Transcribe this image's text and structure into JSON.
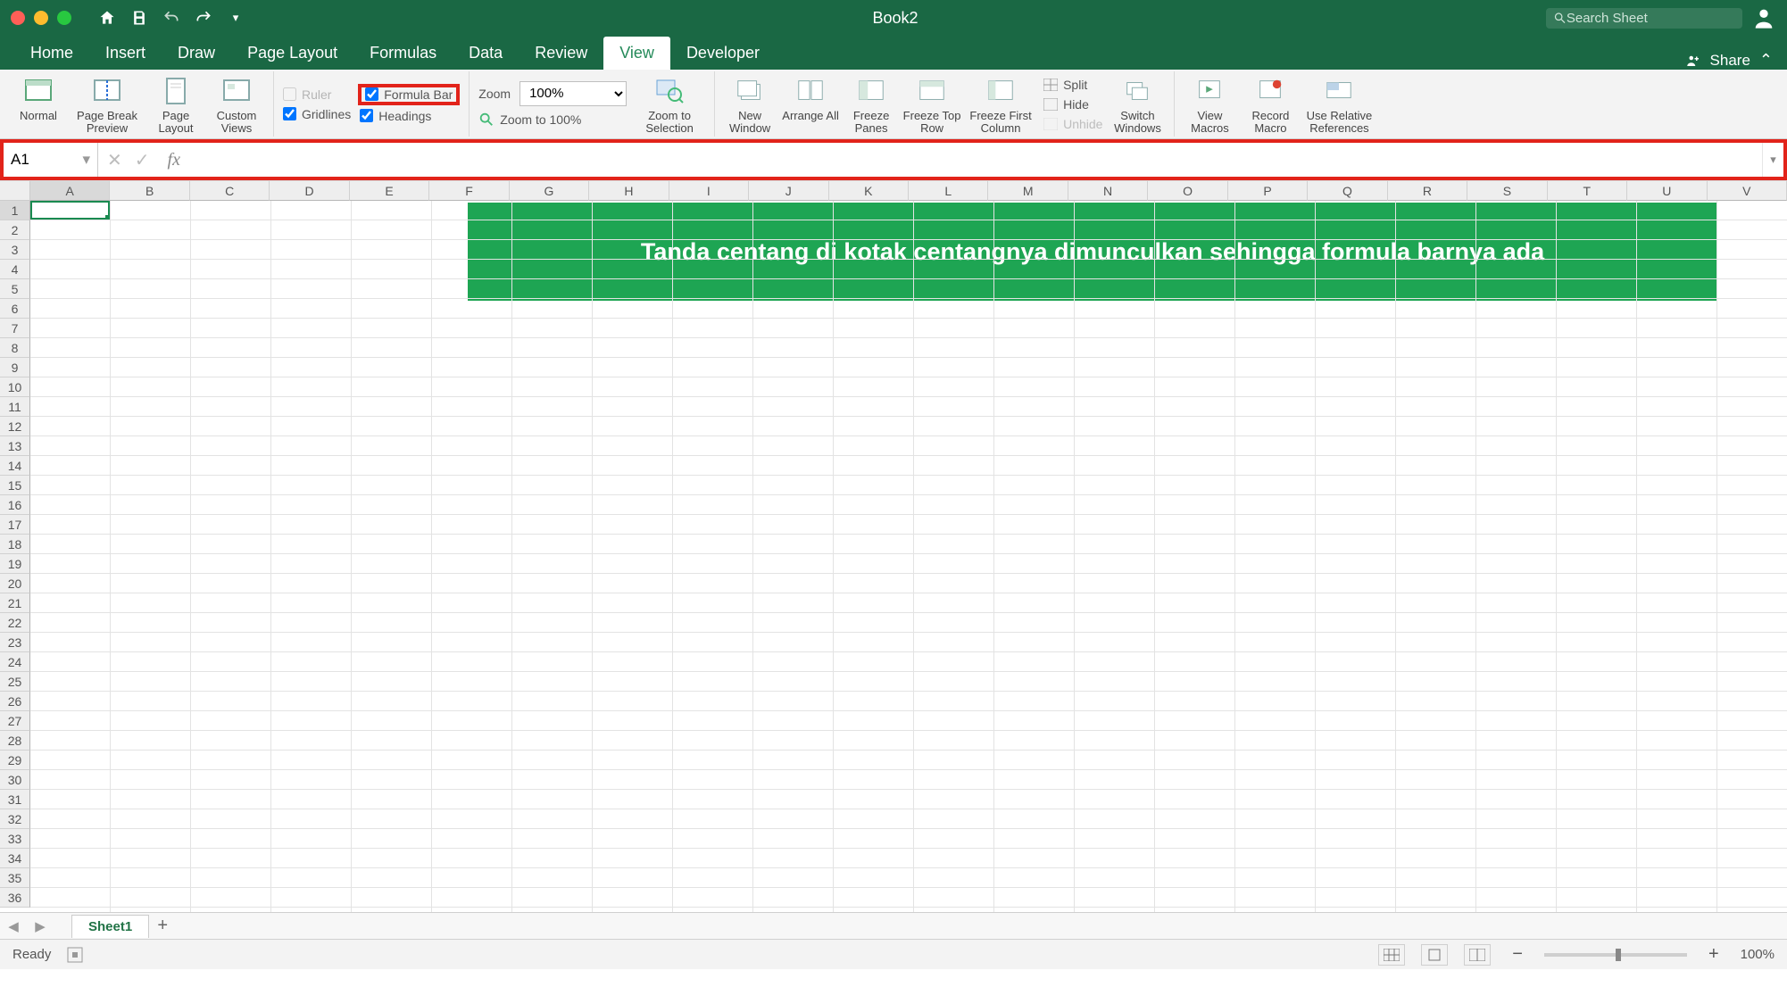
{
  "title": "Book2",
  "search_placeholder": "Search Sheet",
  "tabs": [
    "Home",
    "Insert",
    "Draw",
    "Page Layout",
    "Formulas",
    "Data",
    "Review",
    "View",
    "Developer"
  ],
  "active_tab": "View",
  "share_label": "Share",
  "ribbon": {
    "views": {
      "normal": "Normal",
      "page_break": "Page Break Preview",
      "page_layout": "Page Layout",
      "custom": "Custom Views"
    },
    "show": {
      "ruler": "Ruler",
      "formula_bar": "Formula Bar",
      "gridlines": "Gridlines",
      "headings": "Headings",
      "ruler_checked": false,
      "formula_bar_checked": true,
      "gridlines_checked": true,
      "headings_checked": true
    },
    "zoom": {
      "label": "Zoom",
      "value": "100%",
      "to_100": "Zoom to 100%",
      "to_selection": "Zoom to Selection"
    },
    "window": {
      "new": "New Window",
      "arrange": "Arrange All",
      "freeze_panes": "Freeze Panes",
      "freeze_top": "Freeze Top Row",
      "freeze_first": "Freeze First Column",
      "split": "Split",
      "hide": "Hide",
      "unhide": "Unhide",
      "switch": "Switch Windows"
    },
    "macros": {
      "view": "View Macros",
      "record": "Record Macro",
      "relative": "Use Relative References"
    }
  },
  "name_box": "A1",
  "columns": [
    "A",
    "B",
    "C",
    "D",
    "E",
    "F",
    "G",
    "H",
    "I",
    "J",
    "K",
    "L",
    "M",
    "N",
    "O",
    "P",
    "Q",
    "R",
    "S",
    "T",
    "U",
    "V"
  ],
  "rows": [
    1,
    2,
    3,
    4,
    5,
    6,
    7,
    8,
    9,
    10,
    11,
    12,
    13,
    14,
    15,
    16,
    17,
    18,
    19,
    20,
    21,
    22,
    23,
    24,
    25,
    26,
    27,
    28,
    29,
    30,
    31,
    32,
    33,
    34,
    35,
    36
  ],
  "overlay_text": "Tanda centang di kotak centangnya dimunculkan  sehingga formula barnya ada",
  "sheet_name": "Sheet1",
  "status": "Ready",
  "zoom_pct": "100%"
}
